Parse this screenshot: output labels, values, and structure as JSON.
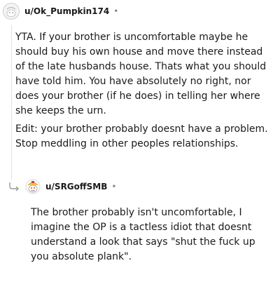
{
  "comment1": {
    "username": "u/Ok_Pumpkin174",
    "separator": "•",
    "paragraphs": [
      "YTA. If your brother is uncomfortable maybe he should buy his own house and move there instead of the late husbands house. Thats what you should have told him. You have absolutely no right, nor does your brother (if he does) in telling her where she keeps the urn.",
      "Edit: your brother probably doesnt have a problem. Stop meddling in other peoples relationships."
    ]
  },
  "comment2": {
    "username": "u/SRGoffSMB",
    "separator": "•",
    "paragraphs": [
      "The brother probably isn't uncomfortable, I imagine the OP is a tactless idiot that doesnt understand a look that says \"shut the fuck up you absolute plank\"."
    ]
  },
  "icons": {
    "avatar1": "snoo-avatar-icon",
    "avatar2": "snoo-avatar-icon",
    "reply": "reply-arrow-icon"
  }
}
